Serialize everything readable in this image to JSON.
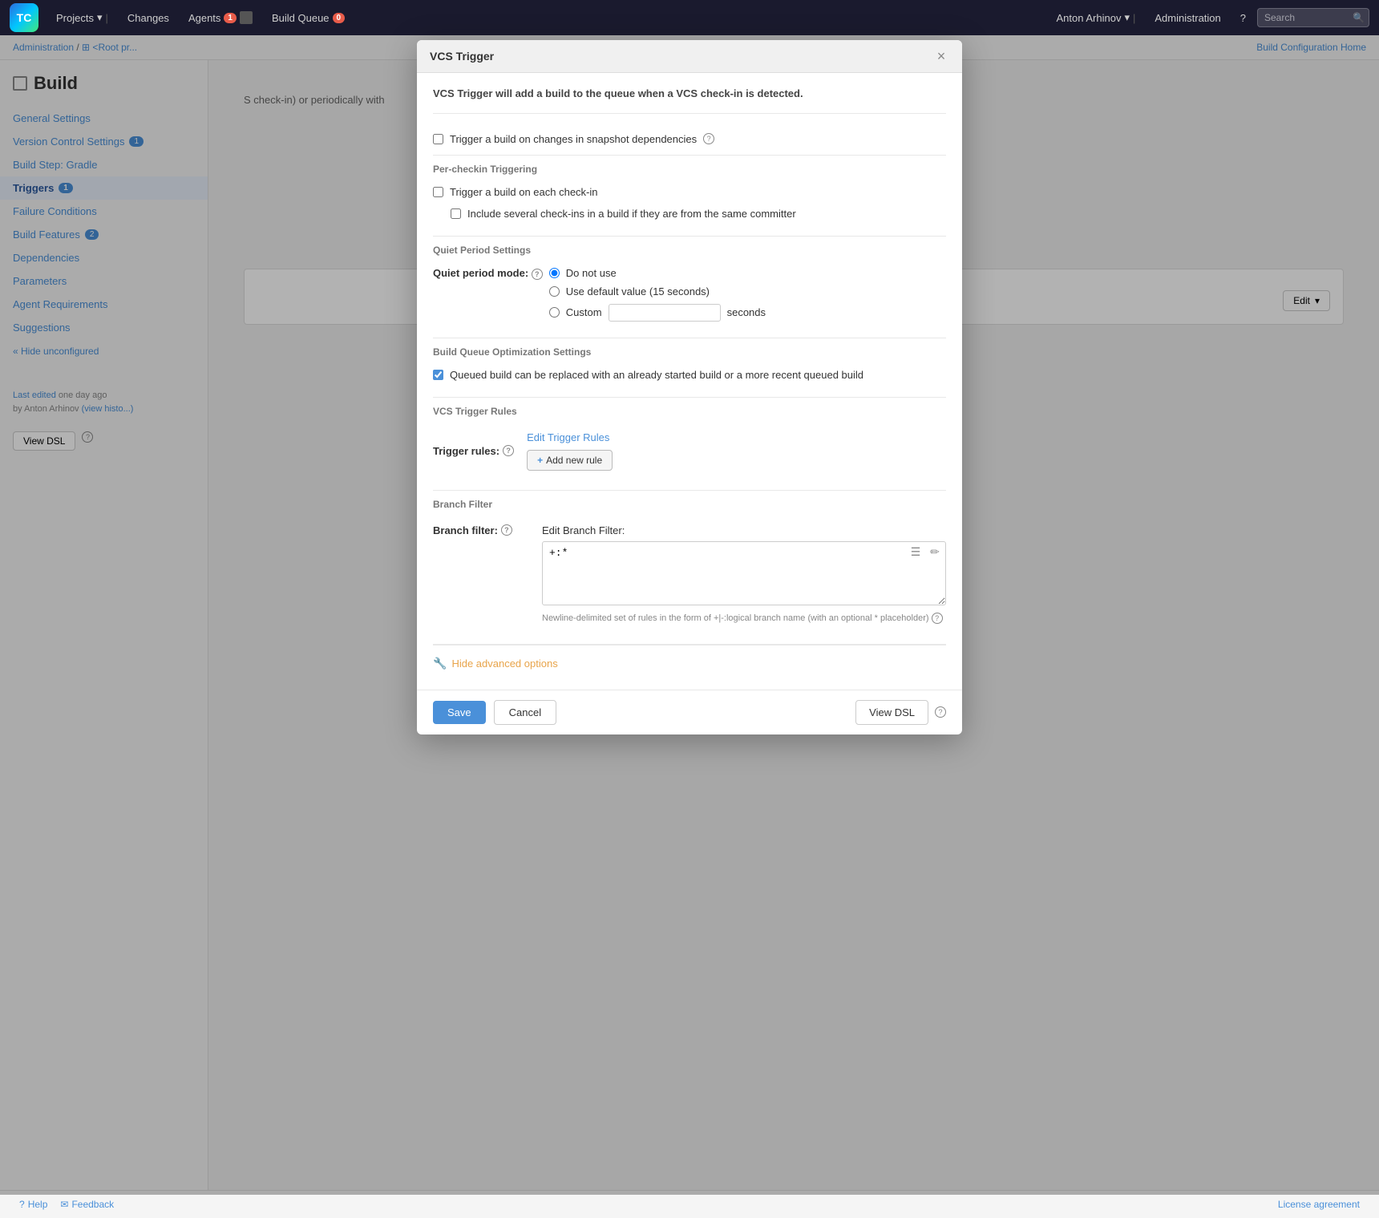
{
  "app": {
    "logo_text": "TC",
    "title": "TeamCity"
  },
  "nav": {
    "items": [
      {
        "label": "Projects",
        "badge": null,
        "has_arrow": true
      },
      {
        "label": "Changes",
        "badge": null,
        "has_arrow": false
      },
      {
        "label": "Agents",
        "badge": "1",
        "has_arrow": false
      },
      {
        "label": "Build Queue",
        "badge": "0",
        "has_arrow": false
      }
    ],
    "user": "Anton Arhinov",
    "admin": "Administration",
    "search_placeholder": "Search"
  },
  "breadcrumb": {
    "items": [
      "Administration",
      "/",
      "⊞ <Root pr..."
    ],
    "right": "Build Configuration Home"
  },
  "sidebar": {
    "page_title": "Build",
    "nav_items": [
      {
        "label": "General Settings",
        "badge": null,
        "active": false
      },
      {
        "label": "Version Control Settings",
        "badge": "1",
        "active": false
      },
      {
        "label": "Build Step: Gradle",
        "badge": null,
        "active": false
      },
      {
        "label": "Triggers",
        "badge": "1",
        "active": true
      },
      {
        "label": "Failure Conditions",
        "badge": null,
        "active": false
      },
      {
        "label": "Build Features",
        "badge": "2",
        "active": false
      },
      {
        "label": "Dependencies",
        "badge": null,
        "active": false
      },
      {
        "label": "Parameters",
        "badge": null,
        "active": false
      },
      {
        "label": "Agent Requirements",
        "badge": null,
        "active": false
      },
      {
        "label": "Suggestions",
        "badge": null,
        "active": false
      }
    ],
    "hide_unconfigured": "« Hide unconfigured",
    "last_edited_label": "Last edited",
    "last_edited_time": "one day ago",
    "last_edited_by": "by Anton Arhinov",
    "view_history_link": "(view histo...)",
    "view_dsl_btn": "View DSL",
    "help_label": "Help",
    "feedback_label": "Feedback"
  },
  "dialog": {
    "title": "VCS Trigger",
    "close_label": "×",
    "description": "VCS Trigger will add a build to the queue when a VCS check-in is detected.",
    "snapshot_dep_label": "Trigger a build on changes in snapshot dependencies",
    "snapshot_dep_checked": false,
    "sections": {
      "per_checkin": {
        "title": "Per-checkin Triggering",
        "trigger_each_label": "Trigger a build on each check-in",
        "trigger_each_checked": false,
        "include_several_label": "Include several check-ins in a build if they are from the same committer",
        "include_several_checked": false
      },
      "quiet_period": {
        "title": "Quiet Period Settings",
        "field_label": "Quiet period mode:",
        "options": [
          {
            "value": "no_use",
            "label": "Do not use",
            "selected": true
          },
          {
            "value": "default",
            "label": "Use default value (15 seconds)",
            "selected": false
          },
          {
            "value": "custom",
            "label": "Custom",
            "selected": false
          }
        ],
        "custom_value": "",
        "custom_placeholder": "",
        "seconds_label": "seconds"
      },
      "queue_optimization": {
        "title": "Build Queue Optimization Settings",
        "label": "Queued build can be replaced with an already started build or a more recent queued build",
        "checked": true
      },
      "trigger_rules": {
        "title": "VCS Trigger Rules",
        "field_label": "Trigger rules:",
        "edit_link": "Edit Trigger Rules",
        "add_rule_btn": "+ Add new rule"
      },
      "branch_filter": {
        "title": "Branch Filter",
        "field_label": "Branch filter:",
        "edit_label": "Edit Branch Filter:",
        "textarea_value": "+:*",
        "hint": "Newline-delimited set of rules in the form of +|-:logical branch name (with an optional * placeholder)"
      }
    },
    "advanced_toggle": "Hide advanced options",
    "footer": {
      "save_btn": "Save",
      "cancel_btn": "Cancel",
      "view_dsl_btn": "View DSL"
    }
  },
  "background": {
    "content_text": "S check-in) or periodically with"
  },
  "footer": {
    "help_label": "Help",
    "feedback_label": "Feedback",
    "license_label": "License agreement"
  }
}
